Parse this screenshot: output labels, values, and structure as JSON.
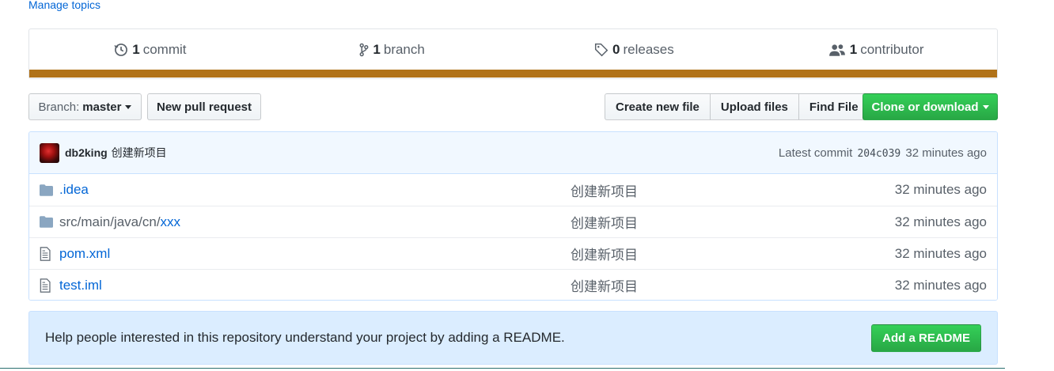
{
  "manage_topics": "Manage topics",
  "summary": {
    "commits": {
      "count": "1",
      "label": "commit"
    },
    "branches": {
      "count": "1",
      "label": "branch"
    },
    "releases": {
      "count": "0",
      "label": "releases"
    },
    "contributors": {
      "count": "1",
      "label": "contributor"
    },
    "language_color": "#b07219"
  },
  "toolbar": {
    "branch_prefix": "Branch:",
    "branch_name": "master",
    "new_pull_request": "New pull request",
    "create_new_file": "Create new file",
    "upload_files": "Upload files",
    "find_file": "Find File",
    "clone_or_download": "Clone or download"
  },
  "commit": {
    "author": "db2king",
    "message": "创建新项目",
    "latest_label": "Latest commit",
    "sha": "204c039",
    "age": "32 minutes ago"
  },
  "files": [
    {
      "type": "folder",
      "name_prefix": "",
      "name": ".idea",
      "message": "创建新项目",
      "age": "32 minutes ago"
    },
    {
      "type": "folder",
      "name_prefix": "src/main/java/cn/",
      "name": "xxx",
      "message": "创建新项目",
      "age": "32 minutes ago"
    },
    {
      "type": "file",
      "name_prefix": "",
      "name": "pom.xml",
      "message": "创建新项目",
      "age": "32 minutes ago"
    },
    {
      "type": "file",
      "name_prefix": "",
      "name": "test.iml",
      "message": "创建新项目",
      "age": "32 minutes ago"
    }
  ],
  "readme": {
    "text": "Help people interested in this repository understand your project by adding a README.",
    "button": "Add a README"
  }
}
